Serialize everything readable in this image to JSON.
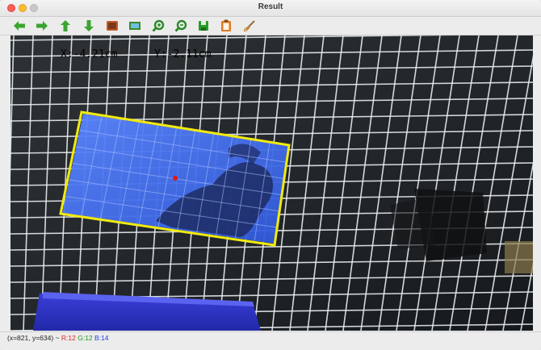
{
  "window": {
    "title": "Result"
  },
  "toolbar": {
    "buttons": [
      {
        "id": "pan-left",
        "icon": "arrow-left-icon",
        "color": "#3aa52f"
      },
      {
        "id": "pan-right",
        "icon": "arrow-right-icon",
        "color": "#3aa52f"
      },
      {
        "id": "pan-up",
        "icon": "arrow-up-icon",
        "color": "#3aa52f"
      },
      {
        "id": "pan-down",
        "icon": "arrow-down-icon",
        "color": "#3aa52f"
      },
      {
        "id": "zoom-fit",
        "icon": "zoom-fit-icon",
        "color": "#c55a2a"
      },
      {
        "id": "zoom-original",
        "icon": "zoom-original-icon",
        "color": "#3a8a2a"
      },
      {
        "id": "zoom-in",
        "icon": "zoom-in-icon",
        "color": "#2a8a2a"
      },
      {
        "id": "zoom-out",
        "icon": "zoom-out-icon",
        "color": "#2a8a2a"
      },
      {
        "id": "save",
        "icon": "save-icon",
        "color": "#2a9a2a"
      },
      {
        "id": "copy",
        "icon": "clipboard-icon",
        "color": "#e07a20"
      },
      {
        "id": "properties",
        "icon": "brush-icon",
        "color": "#c08040"
      }
    ]
  },
  "image": {
    "coord_x_text": "X:-4.21cm",
    "coord_y_text": "Y:-2.11cm",
    "box_color": "#f2ea10",
    "object_color": "#3d6cf0",
    "center_dot_color": "#e01818"
  },
  "status": {
    "position": "(x=821, y=634) ~",
    "r": "R:12",
    "g": "G:12",
    "b": "B:14"
  }
}
